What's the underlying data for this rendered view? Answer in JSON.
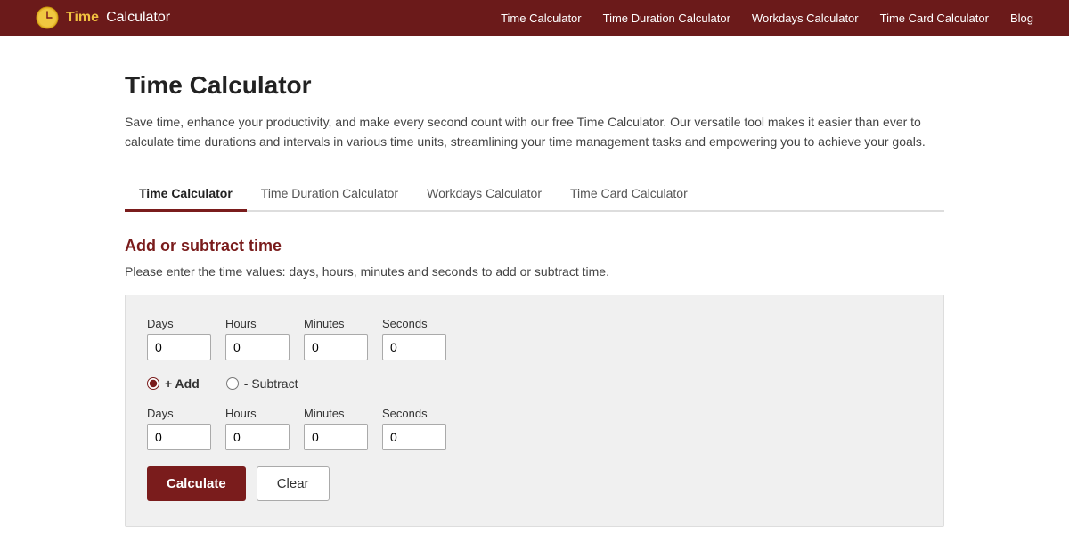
{
  "brand": {
    "time": "Time",
    "calculator": " Calculator"
  },
  "nav": {
    "links": [
      {
        "label": "Time Calculator",
        "href": "#"
      },
      {
        "label": "Time Duration Calculator",
        "href": "#"
      },
      {
        "label": "Workdays Calculator",
        "href": "#"
      },
      {
        "label": "Time Card Calculator",
        "href": "#"
      },
      {
        "label": "Blog",
        "href": "#"
      }
    ]
  },
  "page": {
    "title": "Time Calculator",
    "description": "Save time, enhance your productivity, and make every second count with our free Time Calculator. Our versatile tool makes it easier than ever to calculate time durations and intervals in various time units, streamlining your time management tasks and empowering you to achieve your goals."
  },
  "tabs": [
    {
      "label": "Time Calculator",
      "active": true
    },
    {
      "label": "Time Duration Calculator",
      "active": false
    },
    {
      "label": "Workdays Calculator",
      "active": false
    },
    {
      "label": "Time Card Calculator",
      "active": false
    }
  ],
  "section": {
    "title": "Add or subtract time",
    "description": "Please enter the time values: days, hours, minutes and seconds to add or subtract time."
  },
  "row1": {
    "days_label": "Days",
    "hours_label": "Hours",
    "minutes_label": "Minutes",
    "seconds_label": "Seconds",
    "days_value": "0",
    "hours_value": "0",
    "minutes_value": "0",
    "seconds_value": "0"
  },
  "operation": {
    "add_label": "+ Add",
    "subtract_label": "- Subtract"
  },
  "row2": {
    "days_label": "Days",
    "hours_label": "Hours",
    "minutes_label": "Minutes",
    "seconds_label": "Seconds",
    "days_value": "0",
    "hours_value": "0",
    "minutes_value": "0",
    "seconds_value": "0"
  },
  "buttons": {
    "calculate": "Calculate",
    "clear": "Clear"
  }
}
